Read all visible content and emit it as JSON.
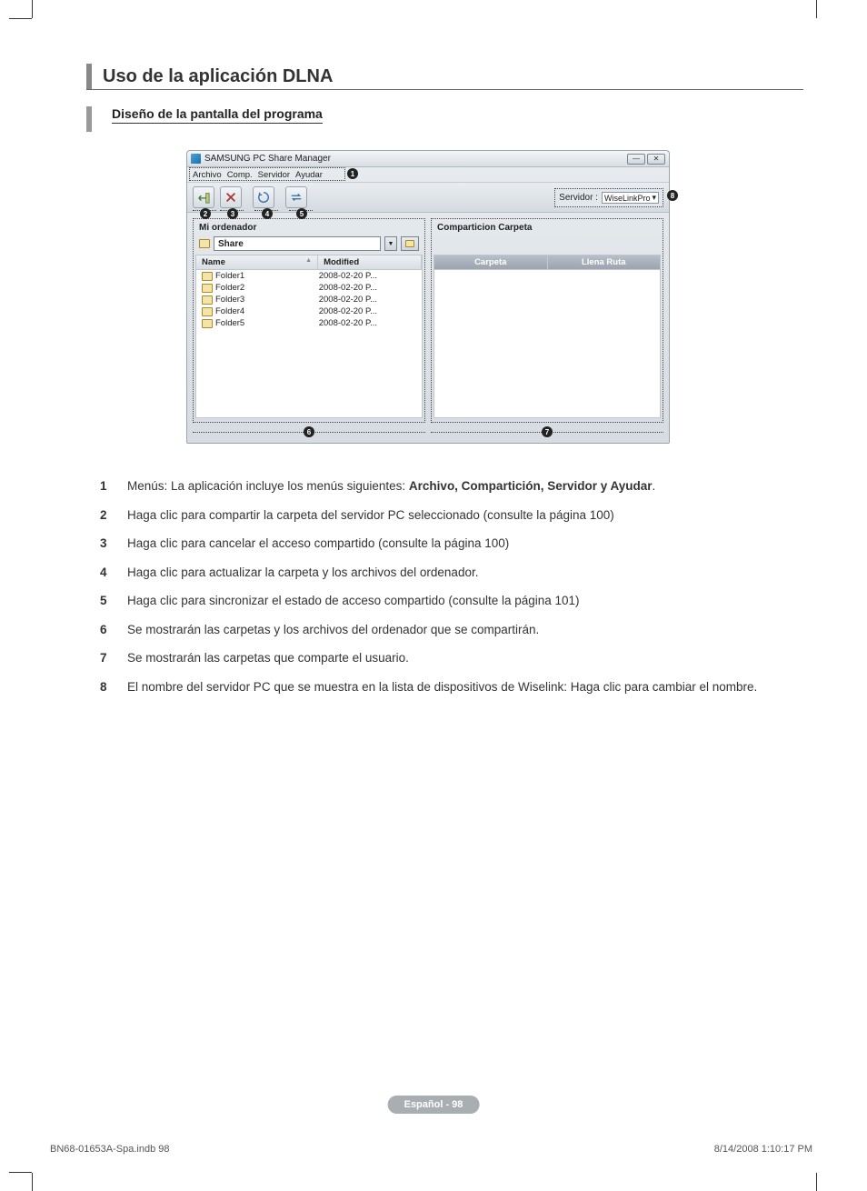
{
  "page": {
    "title": "Uso de la aplicación DLNA",
    "subtitle": "Diseño de la pantalla del programa",
    "badge": "Español - 98"
  },
  "app": {
    "window_title": "SAMSUNG PC Share Manager",
    "menus": [
      "Archivo",
      "Comp.",
      "Servidor",
      "Ayudar"
    ],
    "server_label": "Servidor :",
    "server_value": "WiseLinkPro",
    "left_pane_title": "Mi ordenador",
    "right_pane_title": "Comparticion Carpeta",
    "path_value": "Share",
    "left_cols": {
      "name": "Name",
      "modified": "Modified"
    },
    "right_cols": {
      "carpeta": "Carpeta",
      "llena": "Llena Ruta"
    },
    "folders": [
      {
        "name": "Folder1",
        "mod": "2008-02-20 P..."
      },
      {
        "name": "Folder2",
        "mod": "2008-02-20 P..."
      },
      {
        "name": "Folder3",
        "mod": "2008-02-20 P..."
      },
      {
        "name": "Folder4",
        "mod": "2008-02-20 P..."
      },
      {
        "name": "Folder5",
        "mod": "2008-02-20 P..."
      }
    ],
    "callouts": [
      "1",
      "2",
      "3",
      "4",
      "5",
      "6",
      "7",
      "8"
    ]
  },
  "legend": {
    "1_pre": "Menús: La aplicación incluye los menús siguientes: ",
    "1_bold": "Archivo, Compartición, Servidor y Ayudar",
    "1_post": ".",
    "2": "Haga clic para compartir la carpeta del servidor PC seleccionado (consulte la página 100)",
    "3": "Haga clic para cancelar el acceso compartido (consulte la página 100)",
    "4": "Haga clic para actualizar la carpeta y los archivos del ordenador.",
    "5": "Haga clic para sincronizar el estado de acceso compartido (consulte la página 101)",
    "6": "Se mostrarán las carpetas y los archivos del ordenador que se compartirán.",
    "7": "Se mostrarán las carpetas que comparte el usuario.",
    "8": "El nombre del servidor PC que se muestra en la lista de dispositivos de Wiselink: Haga clic para cambiar el nombre."
  },
  "footer": {
    "left": "BN68-01653A-Spa.indb   98",
    "right": "8/14/2008   1:10:17 PM"
  }
}
